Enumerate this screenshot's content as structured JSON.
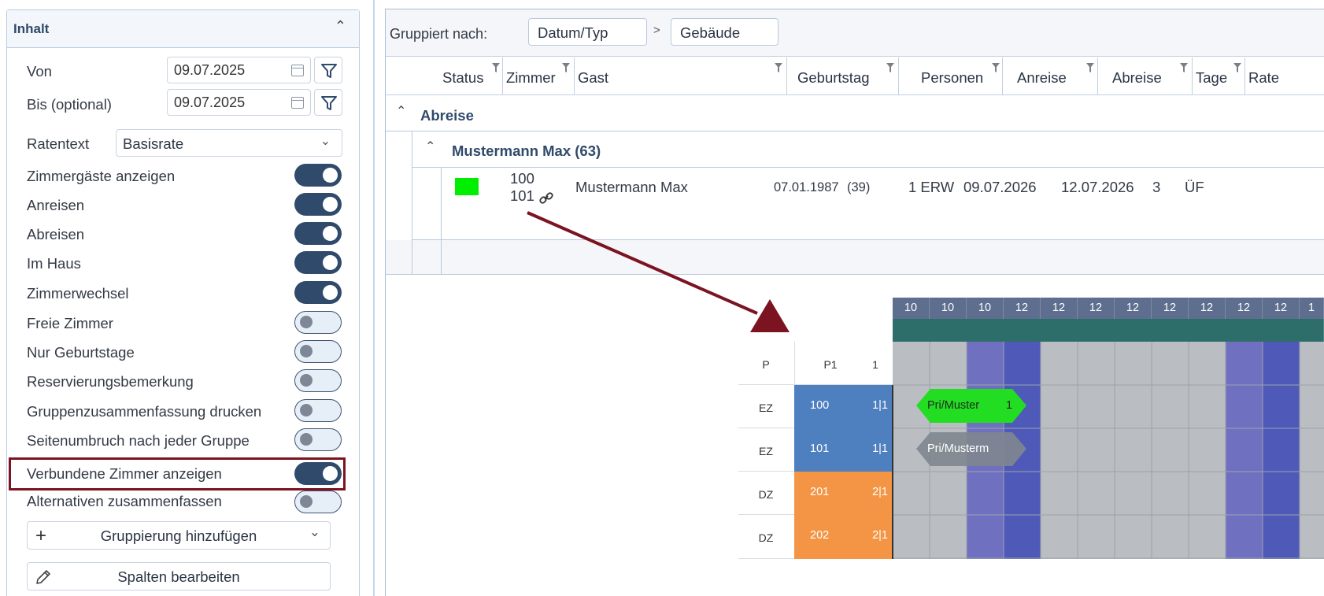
{
  "left_panel": {
    "title": "Inhalt",
    "von_label": "Von",
    "von_value": "09.07.2025",
    "bis_label": "Bis (optional)",
    "bis_value": "09.07.2025",
    "ratentext_label": "Ratentext",
    "ratentext_value": "Basisrate",
    "toggles": [
      {
        "label": "Zimmergäste anzeigen",
        "on": true
      },
      {
        "label": "Anreisen",
        "on": true
      },
      {
        "label": "Abreisen",
        "on": true
      },
      {
        "label": "Im Haus",
        "on": true
      },
      {
        "label": "Zimmerwechsel",
        "on": true
      },
      {
        "label": "Freie Zimmer",
        "on": false
      },
      {
        "label": "Nur Geburtstage",
        "on": false
      },
      {
        "label": "Reservierungsbemerkung",
        "on": false
      },
      {
        "label": "Gruppenzusammenfassung drucken",
        "on": false
      },
      {
        "label": "Seitenumbruch nach jeder Gruppe",
        "on": false
      },
      {
        "label": "Verbundene Zimmer anzeigen",
        "on": true
      },
      {
        "label": "Alternativen zusammenfassen",
        "on": false
      }
    ],
    "add_grouping_label": "Gruppierung hinzufügen",
    "edit_columns_label": "Spalten bearbeiten"
  },
  "grid": {
    "grouped_by_label": "Gruppiert nach:",
    "chips": [
      "Datum/Typ",
      "Gebäude"
    ],
    "chip_separator": ">",
    "columns": [
      "Status",
      "Zimmer",
      "Gast",
      "Geburtstag",
      "Personen",
      "Anreise",
      "Abreise",
      "Tage",
      "Rate"
    ],
    "section_title": "Abreise",
    "subgroup_title": "Mustermann Max (63)",
    "row": {
      "status_color": "#00ee00",
      "room_1": "100",
      "room_2": "101",
      "guest": "Mustermann Max",
      "birthday": "07.01.1987",
      "age": "(39)",
      "persons": "1 ERW",
      "arrival": "09.07.2026",
      "departure": "12.07.2026",
      "days": "3",
      "rate": "ÜF"
    }
  },
  "calendar": {
    "day_numbers": [
      "10",
      "10",
      "10",
      "12",
      "12",
      "12",
      "12",
      "12",
      "12",
      "12",
      "12",
      "1"
    ],
    "header_left": [
      "P",
      "P1",
      "1"
    ],
    "rows": [
      {
        "type": "EZ",
        "room": "100",
        "occ": "1|1",
        "color": "#4e7fbf"
      },
      {
        "type": "EZ",
        "room": "101",
        "occ": "1|1",
        "color": "#4e7fbf"
      },
      {
        "type": "DZ",
        "room": "201",
        "occ": "2|1",
        "color": "#f39545"
      },
      {
        "type": "DZ",
        "room": "202",
        "occ": "2|1",
        "color": "#f39545"
      }
    ],
    "reservation_1_label": "Pri/Muster",
    "reservation_1_count": "1",
    "reservation_2_label": "Pri/Musterm",
    "colors": {
      "accent_dark": "#2f4a6b",
      "highlight_border": "#7c1321",
      "arrow": "#7c1321",
      "res_green": "#22dd22",
      "res_grey": "#7f868f",
      "weekend_purple": "#7070c0",
      "weekend_blue": "#4f5ab8",
      "day_grey": "#babdc1"
    }
  }
}
